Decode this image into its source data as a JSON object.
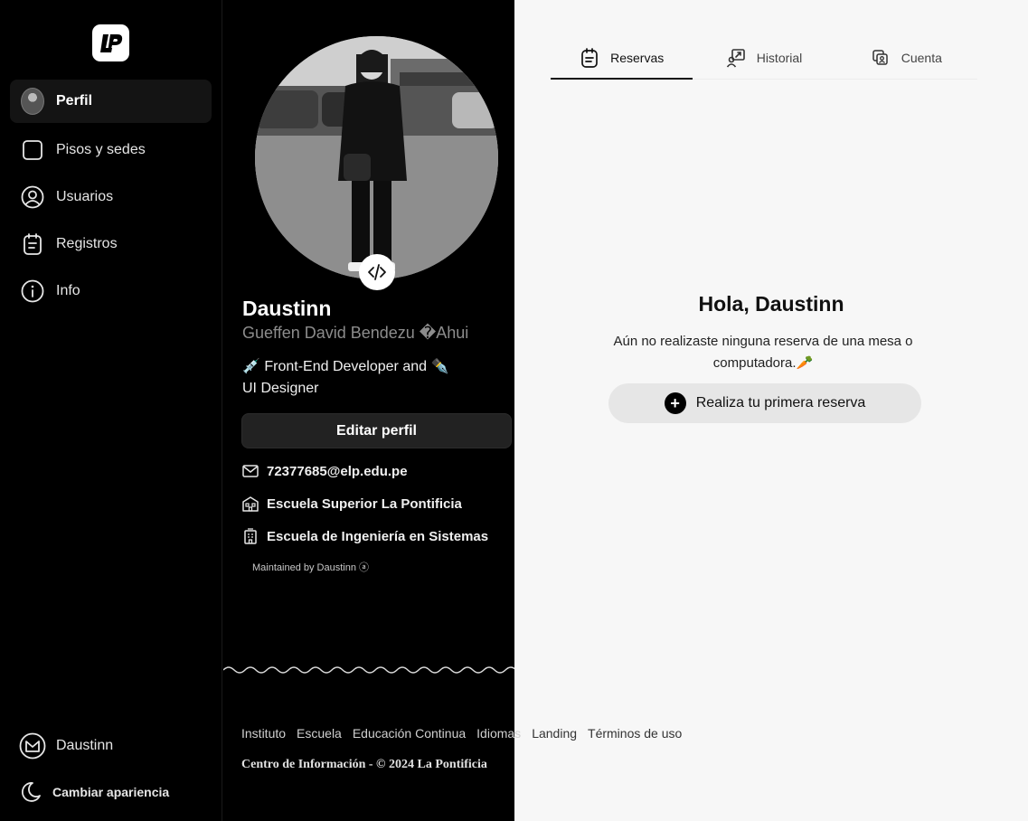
{
  "sidebar": {
    "items": [
      {
        "label": "Perfil",
        "icon": "avatar"
      },
      {
        "label": "Pisos y sedes",
        "icon": "square-icon"
      },
      {
        "label": "Usuarios",
        "icon": "user-circle-icon"
      },
      {
        "label": "Registros",
        "icon": "clipboard-icon"
      },
      {
        "label": "Info",
        "icon": "info-icon"
      }
    ],
    "user_name": "Daustinn",
    "theme_label": "Cambiar apariencia"
  },
  "profile": {
    "username": "Daustinn",
    "full_name": "Gueffen David Bendezu �Ahui",
    "bio": "💉 Front-End Developer and ✒️ UI Designer",
    "edit_label": "Editar perfil",
    "email": "72377685@elp.edu.pe",
    "school": "Escuela Superior La Pontificia",
    "department": "Escuela de Ingeniería en Sistemas",
    "maintained": "Maintained by Daustinn ⓐ"
  },
  "tabs": [
    {
      "label": "Reservas",
      "icon": "calendar-icon",
      "active": true
    },
    {
      "label": "Historial",
      "icon": "history-icon",
      "active": false
    },
    {
      "label": "Cuenta",
      "icon": "account-icon",
      "active": false
    }
  ],
  "main": {
    "greeting": "Hola, Daustinn",
    "empty_message": "Aún no realizaste ninguna reserva de una mesa o computadora.🥕",
    "first_reservation_label": "Realiza tu primera reserva"
  },
  "footer": {
    "links": [
      "Instituto",
      "Escuela",
      "Educación Continua",
      "Idiomas",
      "Landing",
      "Términos de uso"
    ],
    "copyright": "Centro de Información - © 2024 La Pontificia"
  },
  "colors": {
    "dark_bg": "#000000",
    "light_bg": "#f7f7f7",
    "button_light": "#e6e6e6",
    "button_dark": "#222222"
  }
}
